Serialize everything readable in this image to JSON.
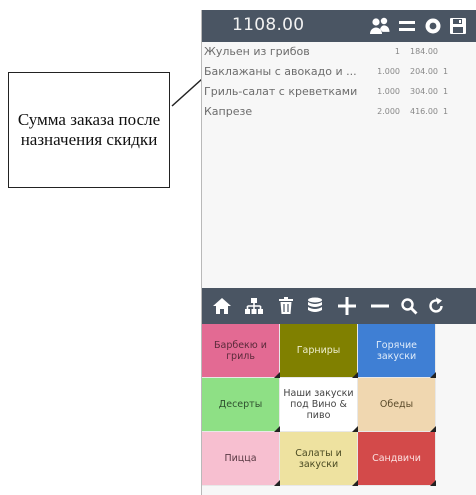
{
  "annotation": {
    "text": "Сумма заказа после назначения скидки"
  },
  "header": {
    "total": "1108.00",
    "icons": [
      "users-icon",
      "menu-icon",
      "settings-icon",
      "save-icon"
    ]
  },
  "order": {
    "items": [
      {
        "name": "Жульен из грибов",
        "qty": "1",
        "price": "184.00",
        "seat": ""
      },
      {
        "name": "Баклажаны с авокадо и ...",
        "qty": "1.000",
        "price": "204.00",
        "seat": "1"
      },
      {
        "name": "Гриль-салат с креветками",
        "qty": "1.000",
        "price": "304.00",
        "seat": "1"
      },
      {
        "name": "Капрезе",
        "qty": "2.000",
        "price": "416.00",
        "seat": "1"
      }
    ]
  },
  "toolbar": {
    "icons": [
      "home-icon",
      "sitemap-icon",
      "trash-icon",
      "database-icon",
      "plus-icon",
      "minus-icon",
      "search-icon",
      "refresh-icon"
    ]
  },
  "categories": [
    {
      "label": "Барбекю и гриль",
      "color": "#e36a93",
      "text_color": "#5a2a3a"
    },
    {
      "label": "Гарниры",
      "color": "#808000",
      "text_color": "#efefcf"
    },
    {
      "label": "Горячие закуски",
      "color": "#3f7fd4",
      "text_color": "#e0ecfa"
    },
    {
      "label": "Десерты",
      "color": "#8ee085",
      "text_color": "#2f4f2f"
    },
    {
      "label": "Наши закуски под Вино & пиво",
      "color": "#ffffff",
      "text_color": "#444444"
    },
    {
      "label": "Обеды",
      "color": "#f0d7b0",
      "text_color": "#5a4a2a"
    },
    {
      "label": "Пицца",
      "color": "#f7bfd0",
      "text_color": "#5a3a44"
    },
    {
      "label": "Салаты и закуски",
      "color": "#eee2a0",
      "text_color": "#4a4a22"
    },
    {
      "label": "Сандвичи",
      "color": "#d34a4a",
      "text_color": "#fbe0e0"
    }
  ]
}
